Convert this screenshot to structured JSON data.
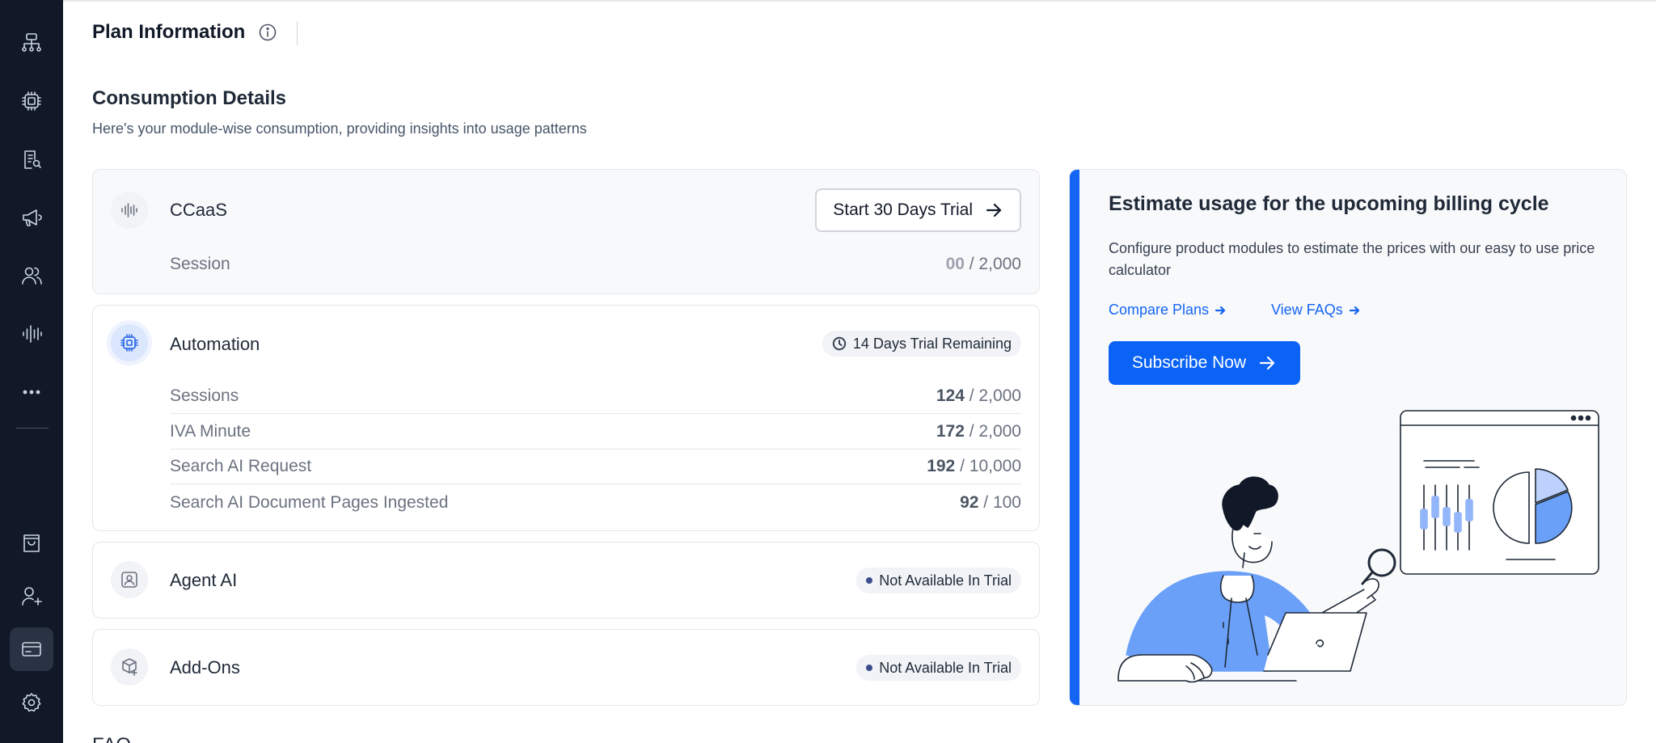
{
  "sidebar": {
    "items": [
      {
        "icon": "org-chart-icon"
      },
      {
        "icon": "chip-icon"
      },
      {
        "icon": "report-search-icon"
      },
      {
        "icon": "megaphone-icon"
      },
      {
        "icon": "users-icon"
      },
      {
        "icon": "waveform-icon"
      },
      {
        "icon": "more-dots-icon"
      },
      {
        "icon": "shopping-bag-icon"
      },
      {
        "icon": "add-user-icon"
      },
      {
        "icon": "credit-card-icon",
        "active": true
      },
      {
        "icon": "settings-gear-icon"
      }
    ]
  },
  "header": {
    "title": "Plan Information"
  },
  "consumption": {
    "title": "Consumption Details",
    "subtitle": "Here's your module-wise consumption, providing insights into usage patterns",
    "modules": {
      "ccaas": {
        "name": "CCaaS",
        "action": "Start 30 Days Trial",
        "rows": [
          {
            "label": "Session",
            "used": "00",
            "total": "/ 2,000"
          }
        ]
      },
      "automation": {
        "name": "Automation",
        "badge": "14 Days Trial Remaining",
        "rows": [
          {
            "label": "Sessions",
            "used": "124",
            "total": "/ 2,000"
          },
          {
            "label": "IVA Minute",
            "used": "172",
            "total": "/ 2,000"
          },
          {
            "label": "Search AI Request",
            "used": "192",
            "total": "/ 10,000"
          },
          {
            "label": "Search AI Document Pages Ingested",
            "used": "92",
            "total": "/ 100"
          }
        ]
      },
      "agent_ai": {
        "name": "Agent AI",
        "badge": "Not Available In Trial"
      },
      "addons": {
        "name": "Add-Ons",
        "badge": "Not Available In Trial"
      }
    }
  },
  "estimate": {
    "title": "Estimate usage for the upcoming billing cycle",
    "description": "Configure product modules to estimate the prices with our easy to use price calculator",
    "compare_link": "Compare Plans",
    "faq_link": "View FAQs",
    "subscribe": "Subscribe Now"
  },
  "footer_peek": "FAQ",
  "colors": {
    "sidebar_bg": "#111827",
    "accent": "#1565f5",
    "badge_dot": "#3b4c8f"
  }
}
